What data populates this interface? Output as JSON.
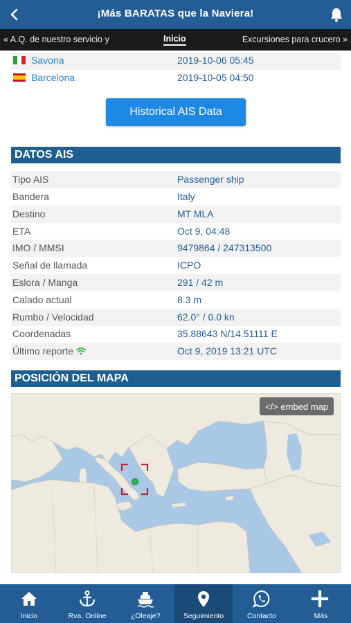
{
  "header": {
    "title": "¡Más BARATAS que la Naviera!",
    "back_icon": "chevron-left-icon",
    "bell_icon": "bell-icon"
  },
  "subnav": {
    "left": "« A.Q. de nuestro servicio y",
    "center": "Inicio",
    "right": "Excursiones para crucero »"
  },
  "ports": [
    {
      "name": "Savona",
      "date": "2019-10-06 05:45",
      "flag": "italy-flag"
    },
    {
      "name": "Barcelona",
      "date": "2019-10-05 04:50",
      "flag": "spain-flag"
    }
  ],
  "ais_button": "Historical AIS Data",
  "datos_ais": {
    "title": "DATOS AIS",
    "rows": [
      {
        "label": "Tipo AIS",
        "value": "Passenger ship"
      },
      {
        "label": "Bandera",
        "value": "Italy"
      },
      {
        "label": "Destino",
        "value": "MT MLA"
      },
      {
        "label": "ETA",
        "value": "Oct 9, 04:48"
      },
      {
        "label": "IMO / MMSI",
        "value": "9479864 / 247313500"
      },
      {
        "label": "Señal de llamada",
        "value": "ICPO"
      },
      {
        "label": "Eslora / Manga",
        "value": "291 / 42 m"
      },
      {
        "label": "Calado actual",
        "value": "8.3 m"
      },
      {
        "label": "Rumbo / Velocidad",
        "value": "62.0° / 0.0 kn"
      },
      {
        "label": "Coordenadas",
        "value": "35.88643 N/14.51111 E"
      },
      {
        "label": "Último reporte",
        "value": "Oct 9, 2019 13:21 UTC"
      }
    ]
  },
  "mapa": {
    "title": "POSICIÓN DEL MAPA",
    "embed_label": "</> embed map"
  },
  "tabs": [
    {
      "label": "Inicio",
      "icon": "home-icon"
    },
    {
      "label": "Rva. Online",
      "icon": "anchor-icon"
    },
    {
      "label": "¿Oleaje?",
      "icon": "ship-icon"
    },
    {
      "label": "Seguimiento",
      "icon": "map-pin-icon",
      "active": true
    },
    {
      "label": "Contacto",
      "icon": "whatsapp-icon"
    },
    {
      "label": "Más",
      "icon": "plus-icon"
    }
  ],
  "colors": {
    "header": "#245d96",
    "section": "#1f5f8f",
    "button": "#1e88e5",
    "link": "#2b82c9"
  }
}
